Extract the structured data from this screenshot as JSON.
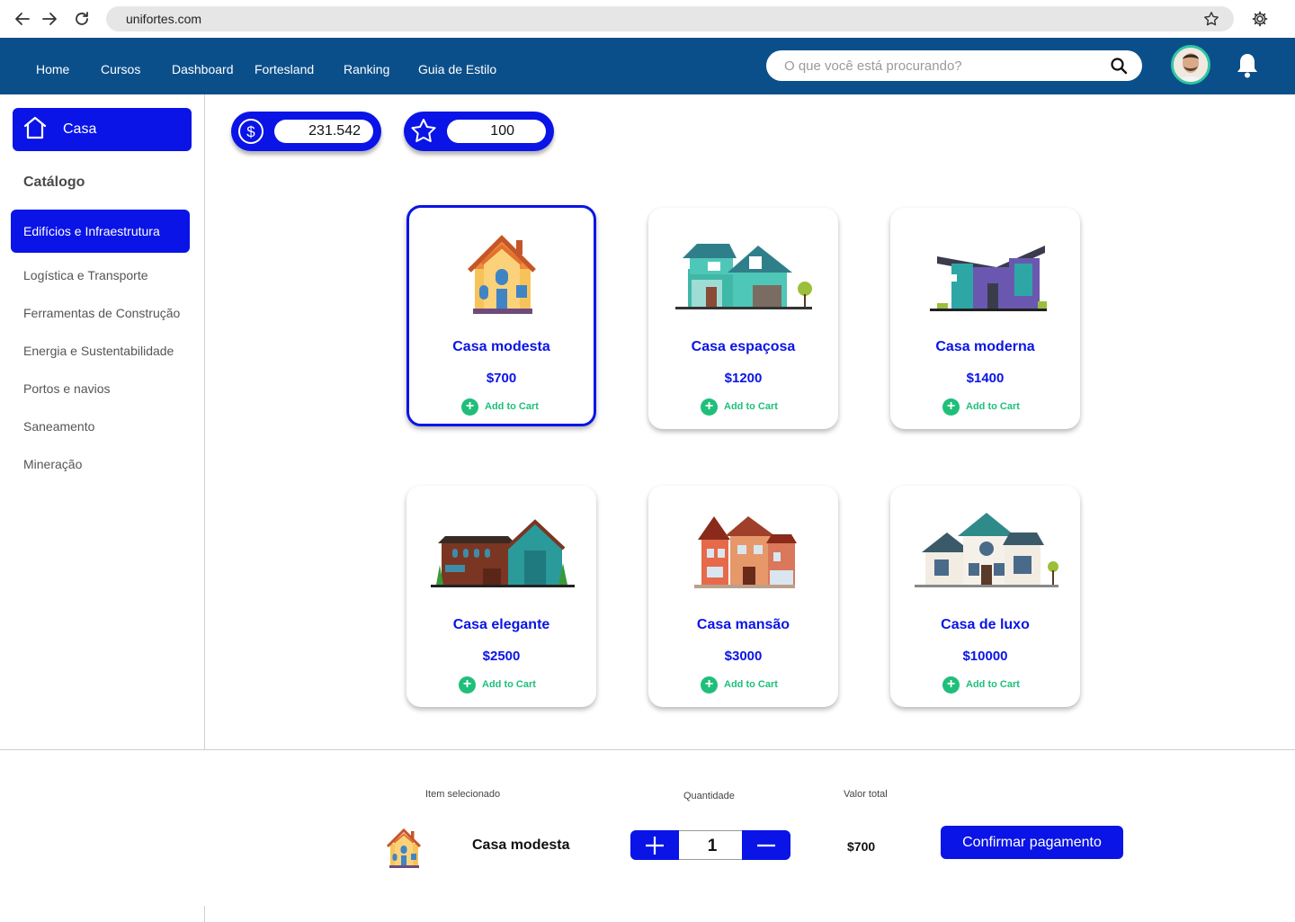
{
  "browser": {
    "url": "unifortes.com",
    "icons": [
      "back-arrow-icon",
      "forward-arrow-icon",
      "reload-icon",
      "bookmark-star-icon",
      "settings-gear-icon"
    ]
  },
  "topnav": {
    "links": [
      "Home",
      "Cursos",
      "Dashboard",
      "Fortesland",
      "Ranking",
      "Guia de Estilo"
    ],
    "search_placeholder": "O que você está procurando?",
    "background": "#0b4f8a"
  },
  "sidebar": {
    "home_label": "Casa",
    "catalog_title": "Catálogo",
    "active_category": "Edifícios e Infraestrutura",
    "categories": [
      "Logística e Transporte",
      "Ferramentas de Construção",
      "Energia e Sustentabilidade",
      "Portos e navios",
      "Saneamento",
      "Mineração"
    ]
  },
  "stats": {
    "coins": "231.542",
    "stars": "100"
  },
  "products": [
    {
      "name": "Casa modesta",
      "price": "$700",
      "cta": "Add to Cart",
      "selected": true
    },
    {
      "name": "Casa espaçosa",
      "price": "$1200",
      "cta": "Add to Cart",
      "selected": false
    },
    {
      "name": "Casa moderna",
      "price": "$1400",
      "cta": "Add to Cart",
      "selected": false
    },
    {
      "name": "Casa elegante",
      "price": "$2500",
      "cta": "Add to Cart",
      "selected": false
    },
    {
      "name": "Casa mansão",
      "price": "$3000",
      "cta": "Add to Cart",
      "selected": false
    },
    {
      "name": "Casa de luxo",
      "price": "$10000",
      "cta": "Add to Cart",
      "selected": false
    }
  ],
  "checkout": {
    "item_label": "Item selecionado",
    "quantity_label": "Quantidade",
    "total_label": "Valor total",
    "item_name": "Casa modesta",
    "quantity": "1",
    "total": "$700",
    "confirm_label": "Confirmar pagamento"
  },
  "colors": {
    "accent": "#0a14e6",
    "success": "#1fbf7a",
    "nav": "#0b4f8a"
  }
}
